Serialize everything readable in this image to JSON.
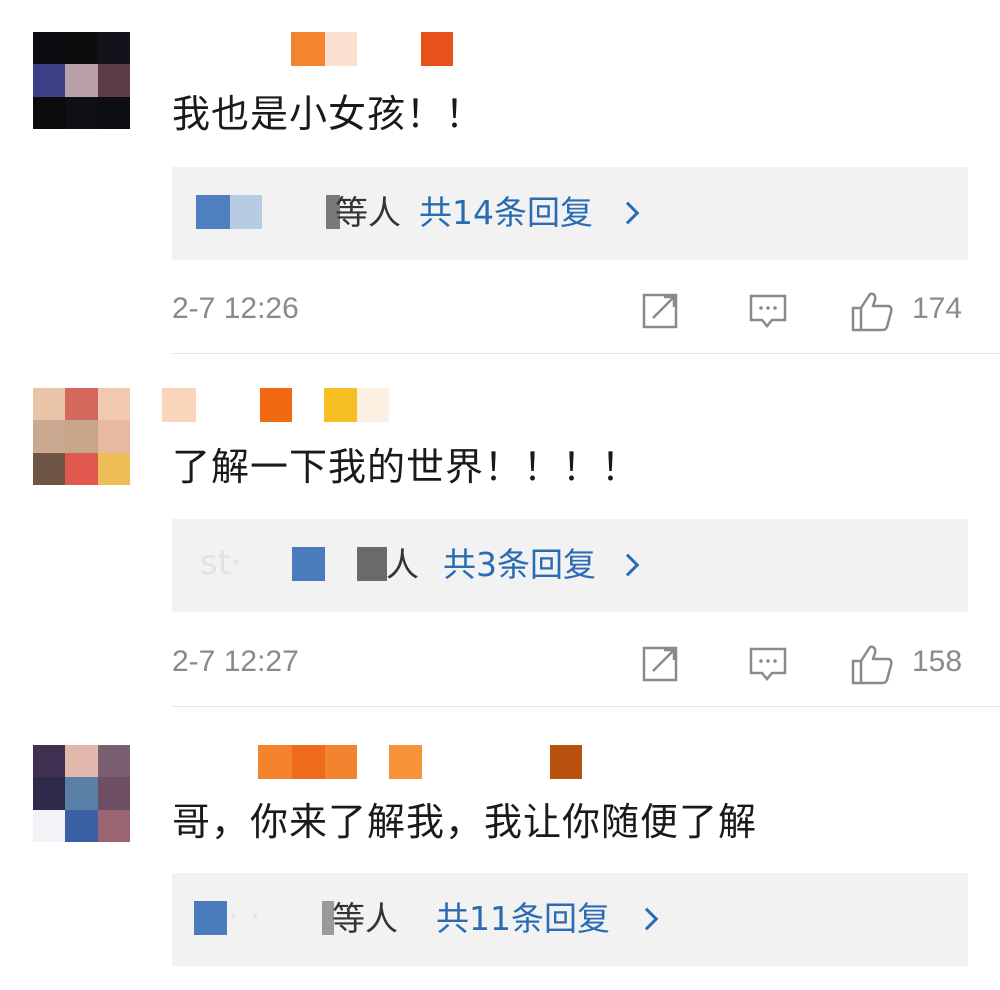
{
  "comments": [
    {
      "text": "我也是小女孩！！",
      "reply_suffix": "等人",
      "reply_count": "共14条回复",
      "timestamp": "2-7 12:26",
      "likes": "174"
    },
    {
      "text": "了解一下我的世界！！！！",
      "reply_suffix": "人",
      "reply_count": "共3条回复",
      "timestamp": "2-7 12:27",
      "likes": "158"
    },
    {
      "text": "哥，你来了解我，我让你随便了解",
      "reply_suffix": "等人",
      "reply_count": "共11条回复"
    }
  ],
  "colors": {
    "link_blue": "#2a6cb3",
    "meta_gray": "#8a8a8a",
    "reply_bg": "#f2f2f2"
  },
  "icons": [
    "share-icon",
    "comment-icon",
    "like-icon",
    "chevron-right-icon"
  ]
}
